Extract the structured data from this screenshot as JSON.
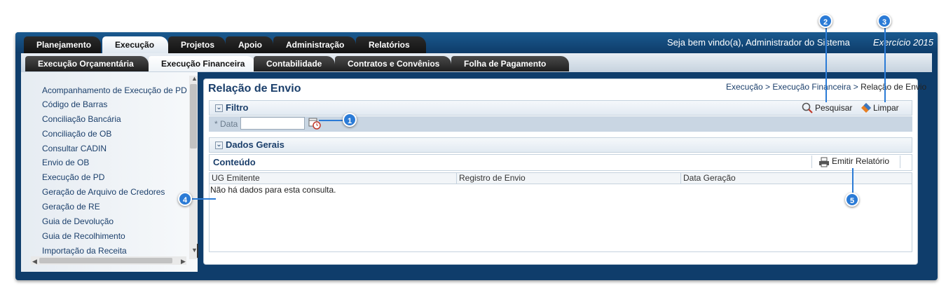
{
  "topnav": {
    "tabs": [
      {
        "label": "Planejamento"
      },
      {
        "label": "Execução"
      },
      {
        "label": "Projetos"
      },
      {
        "label": "Apoio"
      },
      {
        "label": "Administração"
      },
      {
        "label": "Relatórios"
      }
    ],
    "active_index": 1,
    "welcome": "Seja bem vindo(a), Administrador do Sistema",
    "exercicio": "Exercício 2015"
  },
  "subnav": {
    "tabs": [
      {
        "label": "Execução Orçamentária"
      },
      {
        "label": "Execução Financeira"
      },
      {
        "label": "Contabilidade"
      },
      {
        "label": "Contratos e Convênios"
      },
      {
        "label": "Folha de Pagamento"
      }
    ],
    "active_index": 1
  },
  "sidebar": {
    "items": [
      {
        "label": "Acompanhamento de Execução de PD"
      },
      {
        "label": "Código de Barras"
      },
      {
        "label": "Conciliação Bancária"
      },
      {
        "label": "Conciliação de OB"
      },
      {
        "label": "Consultar CADIN"
      },
      {
        "label": "Envio de OB"
      },
      {
        "label": "Execução de PD"
      },
      {
        "label": "Geração de Arquivo de Credores"
      },
      {
        "label": "Geração de RE"
      },
      {
        "label": "Guia de Devolução"
      },
      {
        "label": "Guia de Recolhimento"
      },
      {
        "label": "Importação da Receita"
      }
    ]
  },
  "page": {
    "title": "Relação de Envio",
    "breadcrumb": {
      "part1": "Execução",
      "sep1": " > ",
      "part2": "Execução Financeira",
      "sep2": " > ",
      "current": "Relação de Envio"
    }
  },
  "filtro": {
    "title": "Filtro",
    "search_label": "Pesquisar",
    "clear_label": "Limpar",
    "data_label": "* Data",
    "data_value": ""
  },
  "dados_gerais": {
    "title": "Dados Gerais"
  },
  "conteudo": {
    "title": "Conteúdo",
    "report_label": "Emitir Relatório",
    "columns": [
      "UG Emitente",
      "Registro de Envio",
      "Data Geração"
    ],
    "empty_message": "Não há dados para esta consulta."
  },
  "callouts": [
    "1",
    "2",
    "3",
    "4",
    "5"
  ],
  "colors": {
    "accent": "#2b7bd6",
    "nav_dark": "#0f3d6b",
    "title": "#1b3f6b"
  }
}
